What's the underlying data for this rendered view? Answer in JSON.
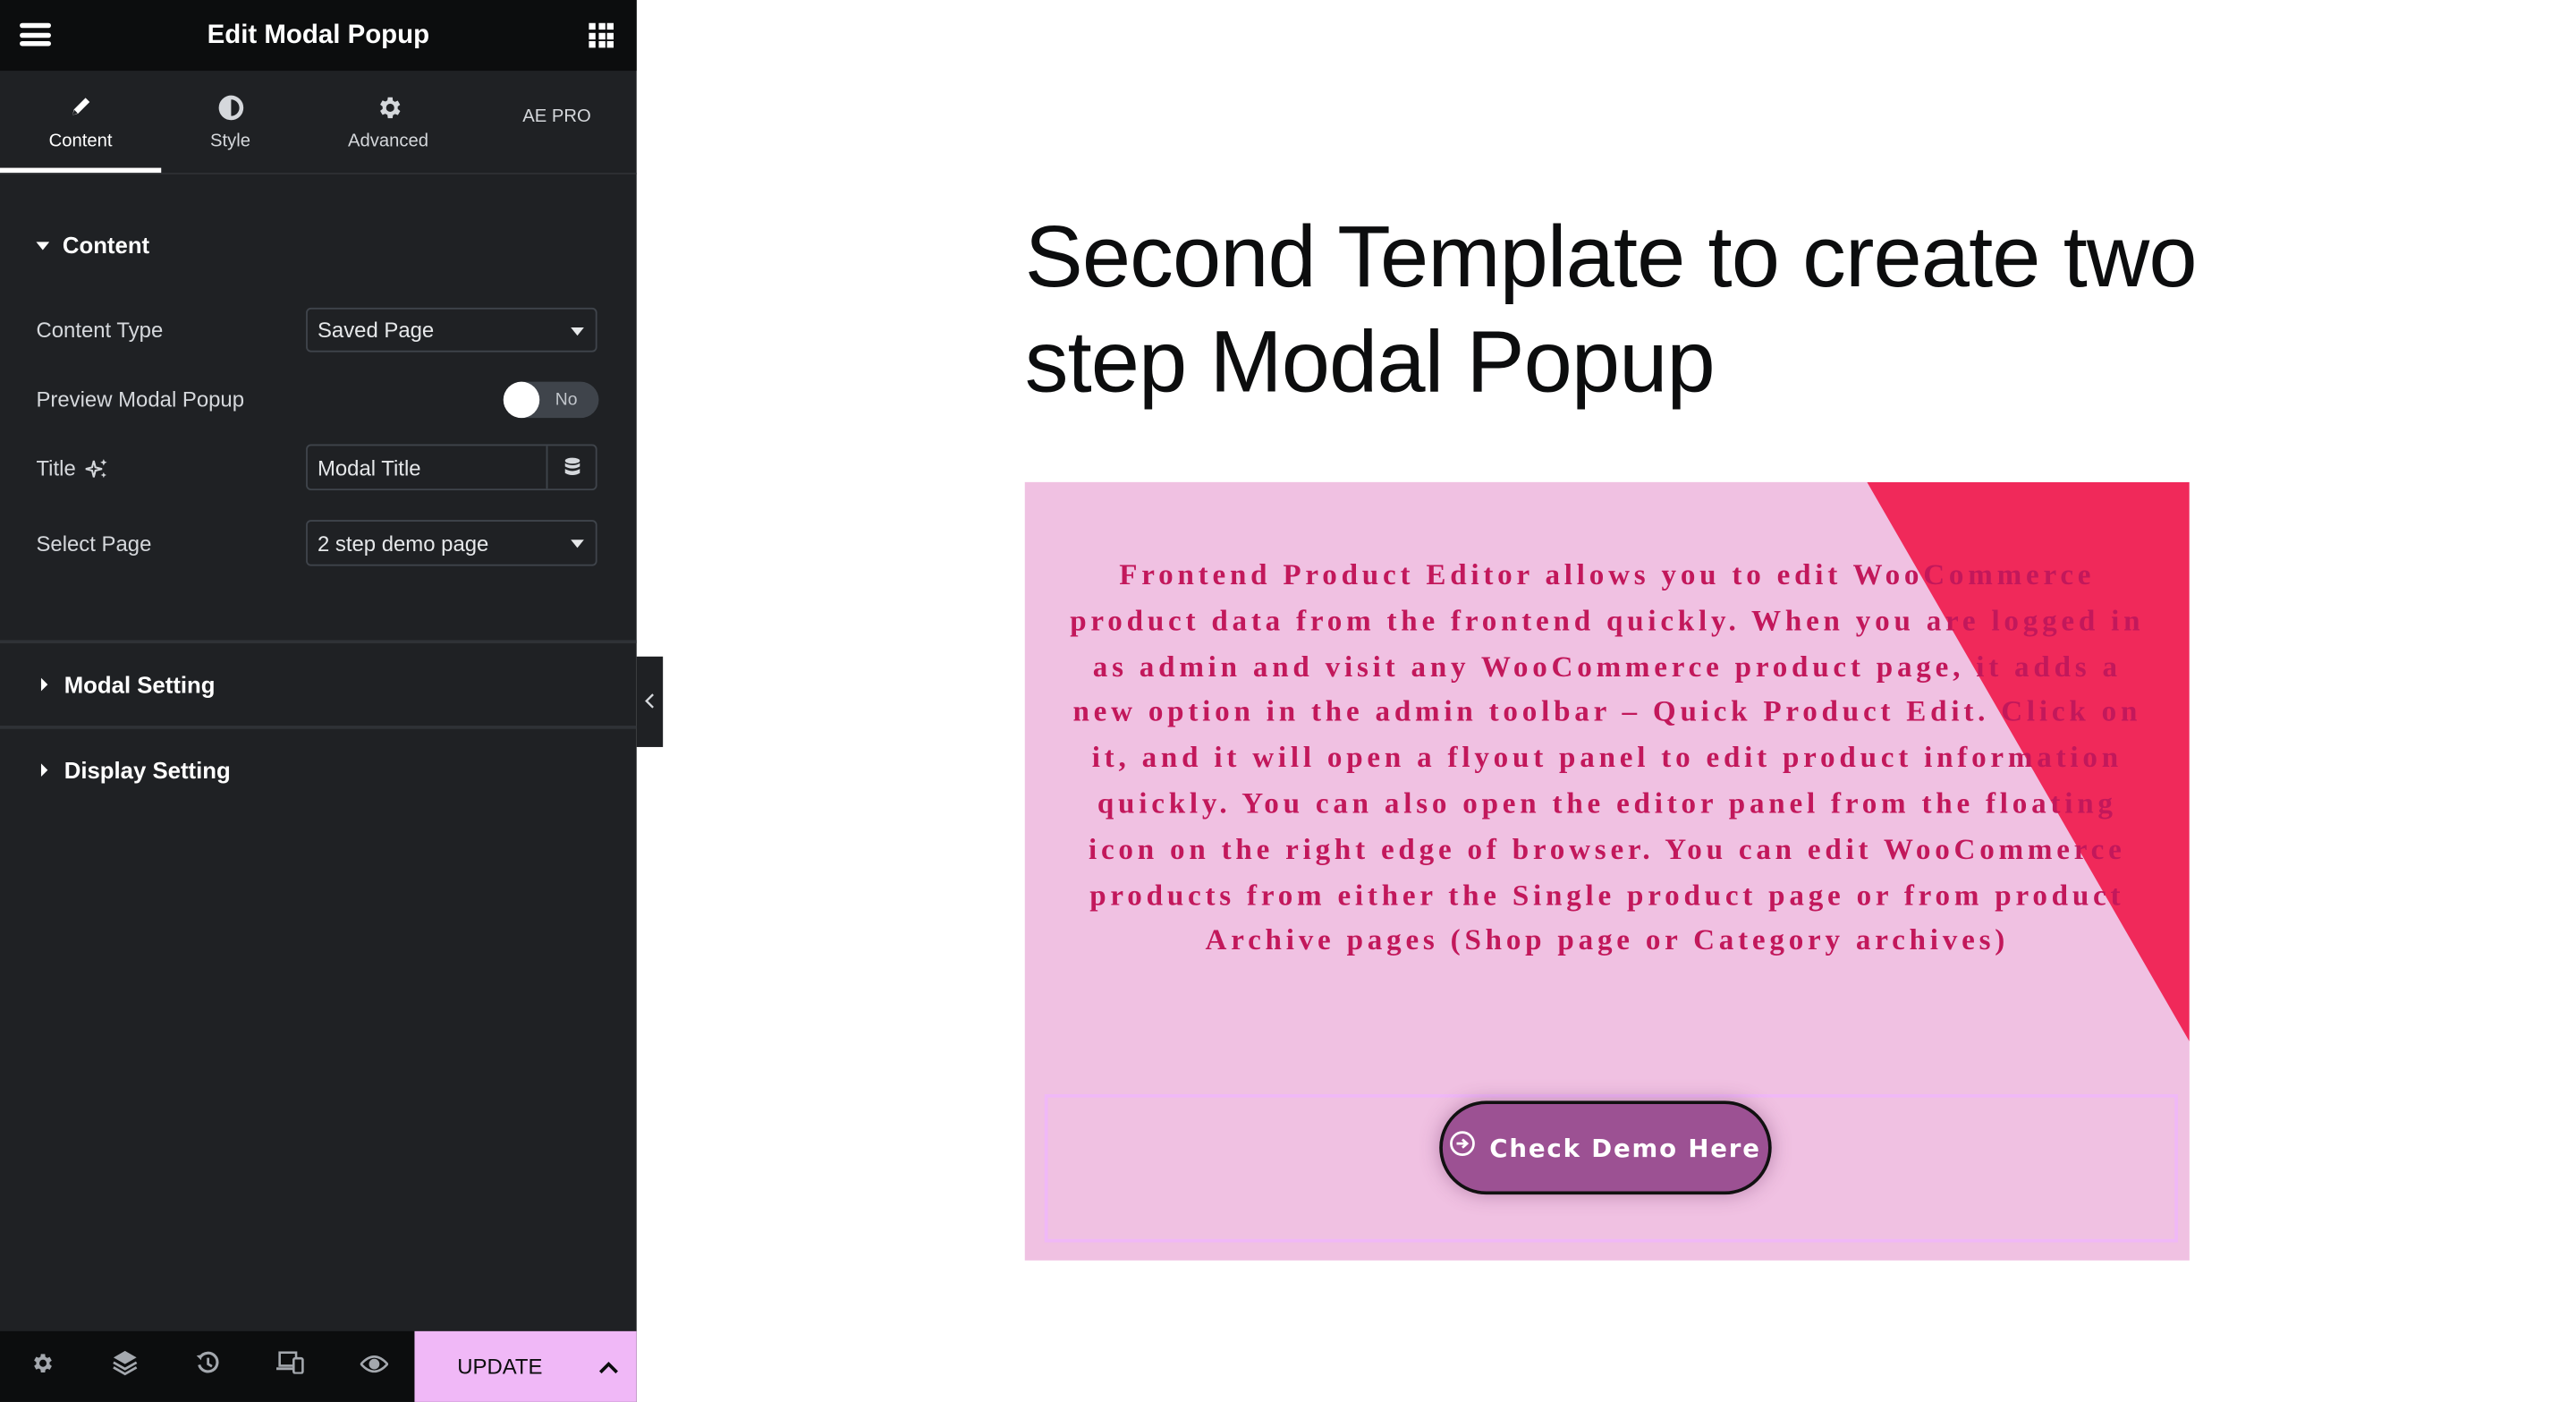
{
  "panel": {
    "title": "Edit Modal Popup",
    "tabs": [
      {
        "label": "Content",
        "icon": "pencil-icon",
        "active": true
      },
      {
        "label": "Style",
        "icon": "half-circle-icon",
        "active": false
      },
      {
        "label": "Advanced",
        "icon": "gear-icon",
        "active": false
      },
      {
        "label": "AE PRO",
        "icon": "",
        "active": false
      }
    ],
    "content_section": {
      "heading": "Content",
      "fields": {
        "content_type": {
          "label": "Content Type",
          "value": "Saved Page"
        },
        "preview_modal": {
          "label": "Preview Modal Popup",
          "value": "No"
        },
        "title": {
          "label": "Title",
          "value": "Modal Title"
        },
        "select_page": {
          "label": "Select Page",
          "value": "2 step demo page"
        }
      }
    },
    "sections": [
      {
        "label": "Modal Setting"
      },
      {
        "label": "Display Setting"
      }
    ],
    "footer": {
      "update_label": "UPDATE"
    }
  },
  "preview": {
    "heading": "Second Template to create two step Modal Popup",
    "body": "Frontend Product Editor allows you to edit WooCommerce product data from the frontend quickly. When you are logged in as admin and visit any WooCommerce product page, it adds a new option in the admin toolbar – Quick Product Edit. Click on it, and it will open a flyout panel to edit product information quickly. You can also open the editor panel from the floating icon on the right edge of browser. You can edit WooCommerce products from either the Single product page or from product Archive pages (Shop page or Category archives)",
    "button_label": "Check Demo Here",
    "colors": {
      "box_bg": "#f0c1e2",
      "accent_triangle": "#f0295a",
      "text": "#c2185b",
      "button_bg": "#9c5193",
      "update_bg": "#f0b8f7"
    }
  }
}
